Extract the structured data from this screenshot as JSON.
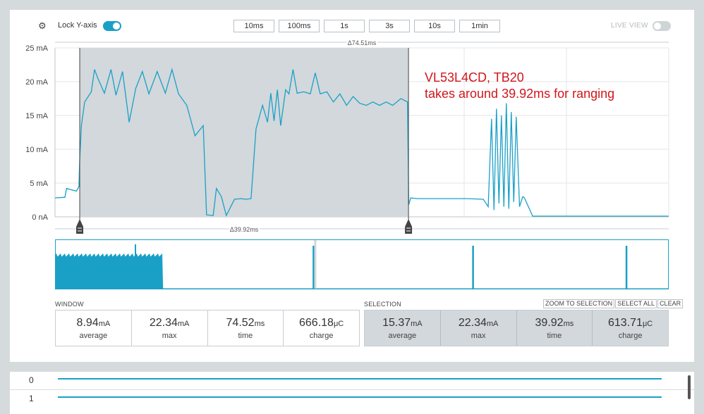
{
  "toolbar": {
    "gear_icon": "gear-icon",
    "lock_y_label": "Lock Y-axis",
    "lock_y_on": true,
    "time_buttons": [
      "10ms",
      "100ms",
      "1s",
      "3s",
      "10s",
      "1min"
    ],
    "live_view_label": "LIVE VIEW",
    "live_view_on": false
  },
  "colors": {
    "trace": "#1aa0c6",
    "selection_fill": "#d2d8dc",
    "annotation": "#d0161b"
  },
  "annotation": {
    "line1": "VL53L4CD, TB20",
    "line2": "takes around 39.92ms for ranging"
  },
  "chart_data": {
    "type": "line",
    "ylabel_unit": "mA",
    "ylim": [
      0,
      25
    ],
    "yticks": [
      "25 mA",
      "20 mA",
      "15 mA",
      "10 mA",
      "5 mA",
      "0 nA"
    ],
    "window_delta_label": "Δ74.51ms",
    "selection_delta_label": "Δ39.92ms",
    "window_ms": 74.52,
    "selection_start_ms": 3.0,
    "selection_end_ms": 42.92,
    "series": [
      {
        "x": [
          0,
          1.2,
          1.4,
          2.6,
          2.9,
          3.0,
          3.2,
          3.6,
          4.4,
          4.8,
          5.2,
          6.0,
          6.8,
          7.4,
          8.2,
          9.0,
          9.8,
          10.6,
          11.4,
          12.4,
          13.4,
          14.2,
          15.0,
          16.0,
          17.0,
          18.0,
          18.4,
          19.2,
          19.6,
          20.2,
          20.8,
          21.8,
          22.6,
          23.2,
          23.8,
          24.4,
          25.2,
          25.8,
          26.2,
          26.6,
          27.0,
          27.4,
          28.0,
          28.4,
          28.9,
          29.4,
          30.2,
          31.0,
          31.6,
          32.2,
          33.0,
          33.8,
          34.6,
          35.4,
          36.2,
          37.0,
          37.8,
          38.6,
          39.4,
          40.2,
          41.0,
          42.0,
          42.8,
          42.95,
          43.2,
          44.0,
          50.0,
          52.0,
          52.6,
          53.0,
          53.3,
          53.6,
          53.9,
          54.2,
          54.5,
          54.8,
          55.1,
          55.4,
          55.7,
          56.0,
          56.4,
          56.8,
          57.0,
          58.0,
          64.0,
          74.5
        ],
        "y": [
          2.8,
          2.9,
          4.2,
          3.8,
          4.5,
          8.5,
          13.5,
          17.0,
          18.5,
          21.8,
          20.5,
          18.3,
          21.8,
          18.0,
          21.5,
          14.0,
          19.0,
          21.5,
          18.2,
          21.5,
          18.3,
          21.8,
          18.2,
          16.5,
          12.0,
          13.5,
          0.3,
          0.2,
          4.2,
          3.0,
          0.2,
          2.6,
          2.7,
          2.6,
          2.7,
          13.0,
          16.5,
          14.0,
          18.3,
          14.2,
          18.8,
          13.5,
          18.8,
          18.2,
          21.8,
          18.3,
          18.5,
          18.2,
          21.3,
          18.2,
          18.5,
          17.0,
          18.2,
          16.5,
          17.8,
          16.8,
          16.5,
          17.0,
          16.5,
          17.0,
          16.5,
          17.5,
          17.0,
          1.8,
          2.8,
          2.7,
          2.7,
          2.6,
          1.5,
          14.5,
          1.0,
          16.0,
          2.0,
          15.0,
          1.5,
          16.8,
          1.2,
          15.5,
          2.2,
          14.8,
          1.5,
          3.0,
          2.8,
          0.1,
          0.1,
          0.1
        ]
      }
    ],
    "grid": true
  },
  "minimap": {
    "spikes": [
      0.42,
      0.68,
      0.93
    ]
  },
  "window_stats": {
    "label": "WINDOW",
    "average": {
      "value": "8.94",
      "unit": "mA",
      "caption": "average"
    },
    "max": {
      "value": "22.34",
      "unit": "mA",
      "caption": "max"
    },
    "time": {
      "value": "74.52",
      "unit": "ms",
      "caption": "time"
    },
    "charge": {
      "value": "666.18",
      "unit": "μC",
      "caption": "charge"
    }
  },
  "selection_stats": {
    "label": "SELECTION",
    "buttons": {
      "zoom": "ZOOM TO SELECTION",
      "select_all": "SELECT ALL",
      "clear": "CLEAR"
    },
    "average": {
      "value": "15.37",
      "unit": "mA",
      "caption": "average"
    },
    "max": {
      "value": "22.34",
      "unit": "mA",
      "caption": "max"
    },
    "time": {
      "value": "39.92",
      "unit": "ms",
      "caption": "time"
    },
    "charge": {
      "value": "613.71",
      "unit": "μC",
      "caption": "charge"
    }
  },
  "digital_channels": [
    {
      "label": "0"
    },
    {
      "label": "1"
    }
  ]
}
